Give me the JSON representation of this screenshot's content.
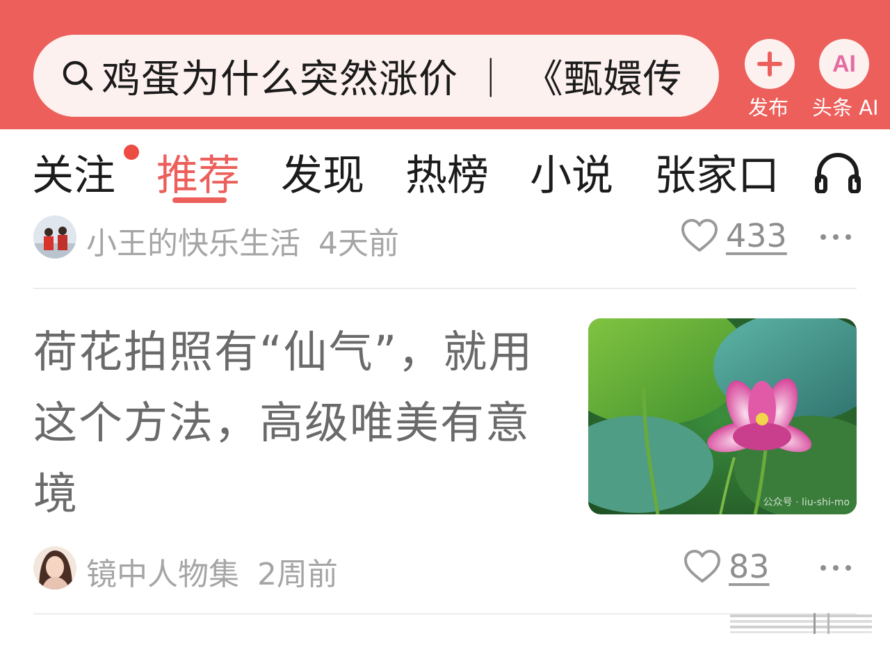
{
  "header": {
    "search_text": "鸡蛋为什么突然涨价 ｜ 《甄嬛传",
    "publish_label": "发布",
    "ai_label": "头条 AI",
    "ai_icon_text": "AI",
    "colors": {
      "bar": "#ec5f5b",
      "search_bg": "#fdf1ef"
    }
  },
  "tabs": [
    {
      "label": "关注",
      "has_dot": true
    },
    {
      "label": "推荐",
      "active": true
    },
    {
      "label": "发现"
    },
    {
      "label": "热榜"
    },
    {
      "label": "小说"
    },
    {
      "label": "张家口"
    }
  ],
  "feed": {
    "item1": {
      "author": "小王的快乐生活",
      "time": "4天前",
      "likes": "433"
    },
    "item2": {
      "title": "荷花拍照有“仙气”，就用这个方法，高级唯美有意境",
      "author": "镜中人物集",
      "time": "2周前",
      "likes": "83",
      "image_watermark": "公众号 · liu-shi-mo"
    }
  },
  "icons": [
    "search-icon",
    "plus-icon",
    "headphones-icon",
    "heart-icon",
    "more-icon"
  ]
}
